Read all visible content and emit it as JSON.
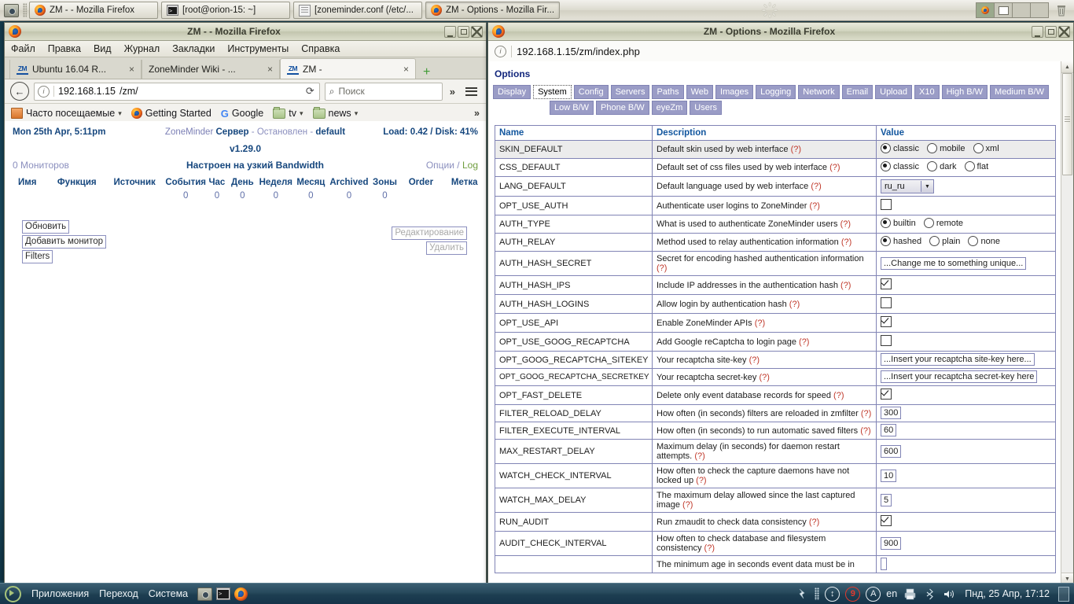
{
  "taskbar": {
    "windows": [
      {
        "label": "ZM - - Mozilla Firefox",
        "icon": "firefox-icon",
        "active": false
      },
      {
        "label": "[root@orion-15: ~]",
        "icon": "terminal-icon",
        "active": false
      },
      {
        "label": "[zoneminder.conf (/etc/...",
        "icon": "text-editor-icon",
        "active": false
      },
      {
        "label": "ZM - Options - Mozilla Fir...",
        "icon": "firefox-icon",
        "active": true
      }
    ],
    "launcher_icon": "screenshot-tool-icon",
    "spinner_icon": "busy-spinner-icon",
    "trash_icon": "trash-icon"
  },
  "left_window": {
    "title": "ZM - - Mozilla Firefox",
    "icon": "firefox-icon",
    "controls": {
      "minimize": "_",
      "maximize": "□",
      "close": "×"
    },
    "menu": [
      "Файл",
      "Правка",
      "Вид",
      "Журнал",
      "Закладки",
      "Инструменты",
      "Справка"
    ],
    "tabs": [
      {
        "label": "Ubuntu 16.04 R...",
        "icon": "zm-favicon",
        "selected": false
      },
      {
        "label": "ZoneMinder Wiki - ...",
        "icon": "none",
        "selected": false
      },
      {
        "label": "ZM -",
        "icon": "zm-favicon",
        "selected": true
      }
    ],
    "new_tab_label": "+",
    "nav": {
      "back_icon": "back-arrow-icon",
      "info_icon": "page-info-icon",
      "url_host": "192.168.1.15",
      "url_path": "/zm/",
      "reload_icon": "reload-icon",
      "search_placeholder": "Поиск",
      "search_icon": "search-icon",
      "overflow_icon": "double-chevron-icon",
      "menu_icon": "hamburger-menu-icon"
    },
    "bookmarks": [
      {
        "label": "Часто посещаемые",
        "icon": "most-visited-icon",
        "has_caret": true
      },
      {
        "label": "Getting Started",
        "icon": "firefox-icon",
        "has_caret": false
      },
      {
        "label": "Google",
        "icon": "google-icon",
        "has_caret": false
      },
      {
        "label": "tv",
        "icon": "folder-icon",
        "has_caret": true
      },
      {
        "label": "news",
        "icon": "folder-icon",
        "has_caret": true
      }
    ],
    "bookmarks_overflow": "»",
    "page": {
      "datetime": "Mon 25th Apr, 5:11pm",
      "brand": "ZoneMinder",
      "server_label": "Сервер",
      "dash1": "-",
      "state": "Остановлен",
      "dash2": "-",
      "server_name": "default",
      "load": "Load: 0.42 / Disk: 41%",
      "version": "v1.29.0",
      "monitors_count": "0 Мониторов",
      "bandwidth": "Настроен на узкий Bandwidth",
      "options_link": "Опции",
      "link_sep": "/",
      "log_link": "Log",
      "columns": [
        "Имя",
        "Функция",
        "Источник",
        "События",
        "Час",
        "День",
        "Неделя",
        "Месяц",
        "Archived",
        "Зоны",
        "Order",
        "Метка"
      ],
      "counts": [
        "0",
        "0",
        "0",
        "0",
        "0",
        "0",
        "0"
      ],
      "buttons_left": [
        "Обновить",
        "Добавить монитор",
        "Filters"
      ],
      "buttons_right": [
        "Редактирование",
        "Удалить"
      ]
    }
  },
  "right_window": {
    "title": "ZM - Options - Mozilla Firefox",
    "icon": "firefox-icon",
    "controls": {
      "minimize": "_",
      "maximize": "□",
      "close": "×"
    },
    "nav": {
      "info_icon": "page-info-icon",
      "url": "192.168.1.15/zm/index.php"
    },
    "page": {
      "heading": "Options",
      "tabs_row1": [
        "Display",
        "System",
        "Config",
        "Servers",
        "Paths",
        "Web",
        "Images",
        "Logging",
        "Network",
        "Email",
        "Upload",
        "X10",
        "High B/W",
        "Medium B/W"
      ],
      "tabs_row2": [
        "Low B/W",
        "Phone B/W",
        "eyeZm",
        "Users"
      ],
      "selected_tab": "System",
      "table_headers": [
        "Name",
        "Description",
        "Value"
      ],
      "rows": [
        {
          "name": "SKIN_DEFAULT",
          "desc": "Default skin used by web interface",
          "type": "radio",
          "options": [
            "classic",
            "mobile",
            "xml"
          ],
          "selected": "classic"
        },
        {
          "name": "CSS_DEFAULT",
          "desc": "Default set of css files used by web interface",
          "type": "radio",
          "options": [
            "classic",
            "dark",
            "flat"
          ],
          "selected": "classic"
        },
        {
          "name": "LANG_DEFAULT",
          "desc": "Default language used by web interface",
          "type": "select",
          "value": "ru_ru"
        },
        {
          "name": "OPT_USE_AUTH",
          "desc": "Authenticate user logins to ZoneMinder",
          "type": "checkbox",
          "checked": false
        },
        {
          "name": "AUTH_TYPE",
          "desc": "What is used to authenticate ZoneMinder users",
          "type": "radio",
          "options": [
            "builtin",
            "remote"
          ],
          "selected": "builtin"
        },
        {
          "name": "AUTH_RELAY",
          "desc": "Method used to relay authentication information",
          "type": "radio",
          "options": [
            "hashed",
            "plain",
            "none"
          ],
          "selected": "hashed"
        },
        {
          "name": "AUTH_HASH_SECRET",
          "desc": "Secret for encoding hashed authentication information",
          "type": "text",
          "value": "...Change me to something unique...",
          "width": "wide"
        },
        {
          "name": "AUTH_HASH_IPS",
          "desc": "Include IP addresses in the authentication hash",
          "type": "checkbox",
          "checked": true
        },
        {
          "name": "AUTH_HASH_LOGINS",
          "desc": "Allow login by authentication hash",
          "type": "checkbox",
          "checked": false
        },
        {
          "name": "OPT_USE_API",
          "desc": "Enable ZoneMinder APIs",
          "type": "checkbox",
          "checked": true
        },
        {
          "name": "OPT_USE_GOOG_RECAPTCHA",
          "desc": "Add Google reCaptcha to login page",
          "type": "checkbox",
          "checked": false
        },
        {
          "name": "OPT_GOOG_RECAPTCHA_SITEKEY",
          "desc": "Your recaptcha site-key",
          "type": "text",
          "value": "...Insert your recaptcha site-key here...",
          "width": "wide"
        },
        {
          "name": "OPT_GOOG_RECAPTCHA_SECRETKEY",
          "desc": "Your recaptcha secret-key",
          "type": "text",
          "value": "...Insert your recaptcha secret-key here",
          "width": "wide"
        },
        {
          "name": "OPT_FAST_DELETE",
          "desc": "Delete only event database records for speed",
          "type": "checkbox",
          "checked": true
        },
        {
          "name": "FILTER_RELOAD_DELAY",
          "desc": "How often (in seconds) filters are reloaded in zmfilter",
          "type": "text",
          "value": "300",
          "width": "narrow"
        },
        {
          "name": "FILTER_EXECUTE_INTERVAL",
          "desc": "How often (in seconds) to run automatic saved filters",
          "type": "text",
          "value": "60",
          "width": "narrow"
        },
        {
          "name": "MAX_RESTART_DELAY",
          "desc": "Maximum delay (in seconds) for daemon restart attempts.",
          "type": "text",
          "value": "600",
          "width": "narrow"
        },
        {
          "name": "WATCH_CHECK_INTERVAL",
          "desc": "How often to check the capture daemons have not locked up",
          "type": "text",
          "value": "10",
          "width": "narrow"
        },
        {
          "name": "WATCH_MAX_DELAY",
          "desc": "The maximum delay allowed since the last captured image",
          "type": "text",
          "value": "5",
          "width": "narrow"
        },
        {
          "name": "RUN_AUDIT",
          "desc": "Run zmaudit to check data consistency",
          "type": "checkbox",
          "checked": true
        },
        {
          "name": "AUDIT_CHECK_INTERVAL",
          "desc": "How often to check database and filesystem consistency",
          "type": "text",
          "value": "900",
          "width": "narrow"
        },
        {
          "name": "",
          "desc": "The minimum age in seconds event data must be in",
          "type": "text",
          "value": "",
          "width": "narrow"
        }
      ],
      "help_marker": "(?)"
    },
    "scrollbar": {
      "up_arrow": "▲",
      "down_arrow": "▼"
    }
  },
  "bottom_panel": {
    "menus": [
      "Приложения",
      "Переход",
      "Система"
    ],
    "launchers": [
      "screenshot-tool-icon",
      "terminal-icon",
      "firefox-icon"
    ],
    "tray": [
      "network-icon",
      "grip-icon",
      "update-icon",
      "notifications-icon",
      "accessibility-icon"
    ],
    "keyboard_layout": "en",
    "notification_count": "9",
    "accessibility_letter": "A",
    "clock": "Пнд, 25 Апр, 17:12",
    "printer_icon": "printer-icon",
    "bluetooth_icon": "bluetooth-icon",
    "volume_icon": "volume-icon"
  },
  "colors": {
    "zm_blue": "#16477e",
    "zm_lavender": "#8b8fbe",
    "tab_purple": "#9a9cc6",
    "desktop": "#1d4a63",
    "panel": "#27495c"
  }
}
